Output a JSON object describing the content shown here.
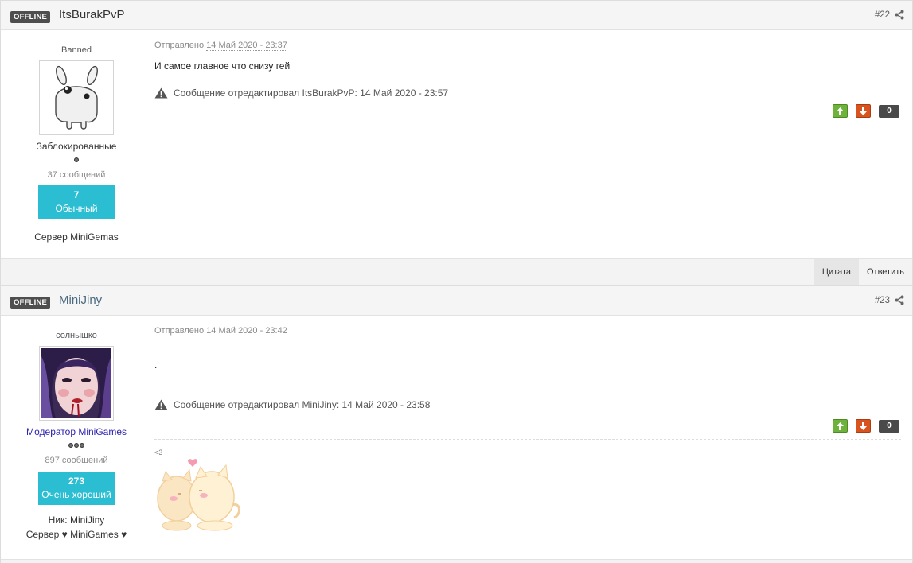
{
  "posts": [
    {
      "status": "OFFLINE",
      "author": "ItsBurakPvP",
      "post_number": "#22",
      "user_title": "Banned",
      "group": "Заблокированные",
      "post_count": "37 сообщений",
      "reputation": {
        "value": "7",
        "label": "Обычный"
      },
      "custom_field_lines": [
        "Сервер MiniGemas"
      ],
      "posted_prefix": "Отправлено",
      "posted_date": "14 Май 2020 - 23:37",
      "body_text": "И самое главное что снизу гей",
      "edit_note": "Сообщение отредактировал ItsBurakPvP: 14 Май 2020 - 23:57",
      "votes": "0"
    },
    {
      "status": "OFFLINE",
      "author": "MiniJiny",
      "post_number": "#23",
      "user_title": "солнышко",
      "group": "Модератор MiniGames",
      "post_count": "897 сообщений",
      "reputation": {
        "value": "273",
        "label": "Очень хороший"
      },
      "custom_field_lines": [
        "Ник: MiniJiny",
        "Сервер ♥ MiniGames ♥"
      ],
      "posted_prefix": "Отправлено",
      "posted_date": "14 Май 2020 - 23:42",
      "body_text": ".",
      "edit_note": "Сообщение отредактировал MiniJiny: 14 Май 2020 - 23:58",
      "votes": "0",
      "signature_text": "<3"
    }
  ],
  "footer": {
    "quote_label": "Цитата",
    "reply_label": "Ответить"
  },
  "icons": {
    "share": "share-icon",
    "warning": "warning-icon",
    "vote_up": "arrow-up-icon",
    "vote_down": "arrow-down-icon"
  },
  "colors": {
    "rep_box": "#2bbed2",
    "vote_up": "#6fb23b",
    "vote_down": "#d9531e",
    "moderator_group": "#2a1fb0",
    "offline_badge": "#4e4e4e"
  }
}
